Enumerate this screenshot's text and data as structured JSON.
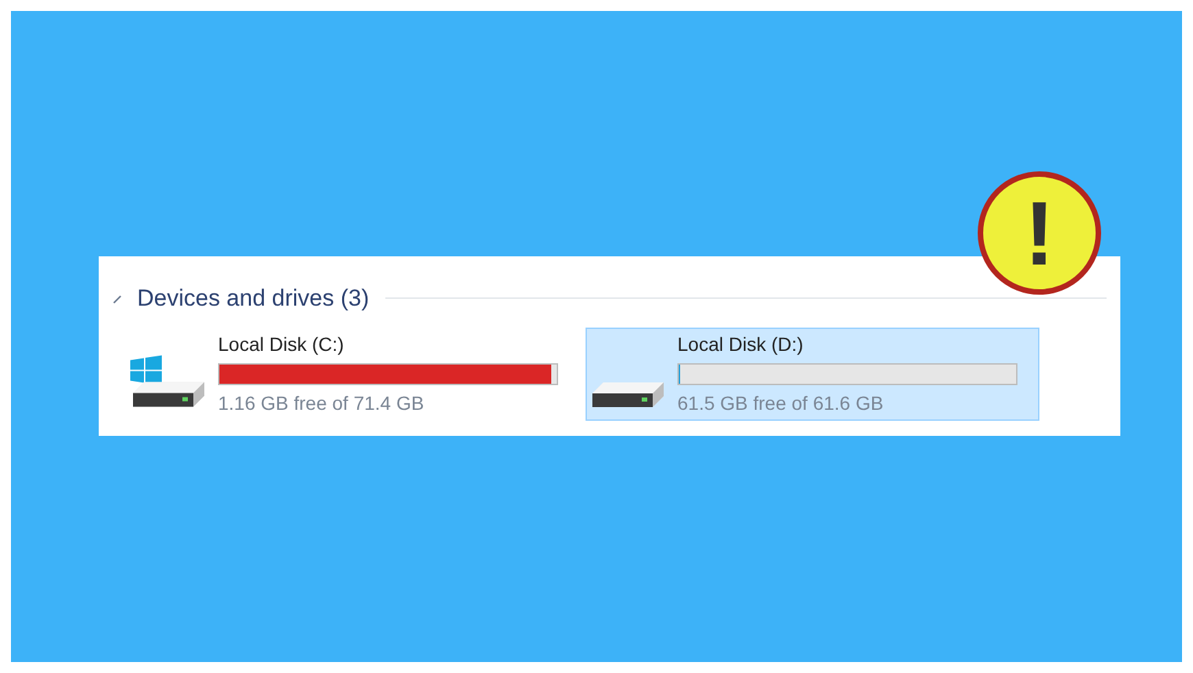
{
  "section": {
    "title": "Devices and drives (3)",
    "expanded": true
  },
  "drives": [
    {
      "name": "Local Disk (C:)",
      "kind": "system",
      "selected": false,
      "level": 0.985,
      "reading": "1.16 GB free of 71.4 GB"
    },
    {
      "name": "Local Disk (D:)",
      "kind": "plain",
      "selected": true,
      "level": 0.002,
      "reading": "61.5 GB free of 61.6 GB"
    }
  ],
  "warning": {
    "mark": "!"
  }
}
